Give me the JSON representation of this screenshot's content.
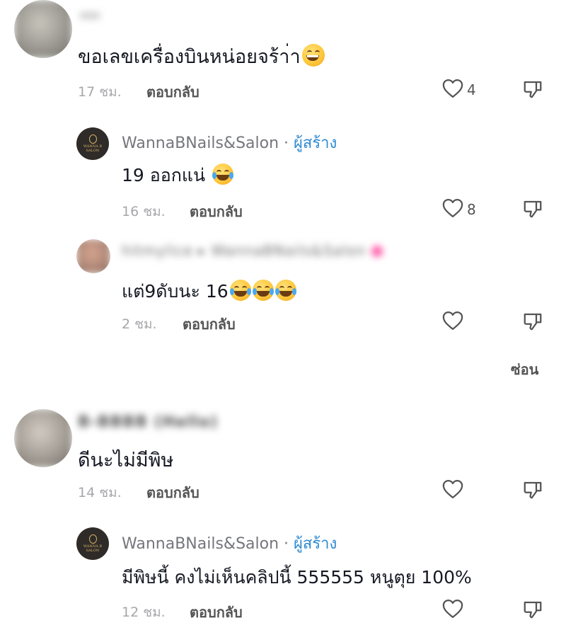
{
  "comments": [
    {
      "text": "ขอเลขเครื่องบินหน่อยจร้า่า",
      "emoji": "grin",
      "time": "17 ชม.",
      "reply_label": "ตอบกลับ",
      "likes": "4",
      "avatar_color": "#9a9890",
      "replies": [
        {
          "author": "WannaBNails&Salon",
          "separator": " · ",
          "badge": "ผู้สร้าง",
          "text": "19 ออกแน่",
          "emoji": "tears",
          "time": "16 ชม.",
          "reply_label": "ตอบกลับ",
          "likes": "8",
          "logo_text": [
            "WANNA B",
            "SALON"
          ]
        },
        {
          "author_blurred": "hitmylice ▸ WannaBNails&Salon",
          "text": "แต่9ดับนะ 16",
          "emoji_count": 3,
          "time": "2 ชม.",
          "reply_label": "ตอบกลับ",
          "likes": "",
          "avatar_color": "#b08878"
        }
      ],
      "hide_label": "ซ่อน"
    },
    {
      "author_blurred": "B-BBBB (Hello)",
      "text": "ดีนะไม่มีพิษ",
      "time": "14 ชม.",
      "reply_label": "ตอบกลับ",
      "likes": "",
      "avatar_color": "#a29c94",
      "replies": [
        {
          "author": "WannaBNails&Salon",
          "separator": " · ",
          "badge": "ผู้สร้าง",
          "text": "มีพิษนี้ คงไม่เห็นคลิปนี้ 555555 หนูตุย 100%",
          "time": "12 ชม.",
          "reply_label": "ตอบกลับ",
          "likes": "",
          "logo_text": [
            "WANNA B",
            "SALON"
          ]
        }
      ]
    }
  ],
  "colors": {
    "creator_badge": "#2e8bd1",
    "meta_text": "#a7a7ab",
    "action_text": "#545454"
  },
  "icons": [
    "heart-icon",
    "dislike-icon"
  ]
}
